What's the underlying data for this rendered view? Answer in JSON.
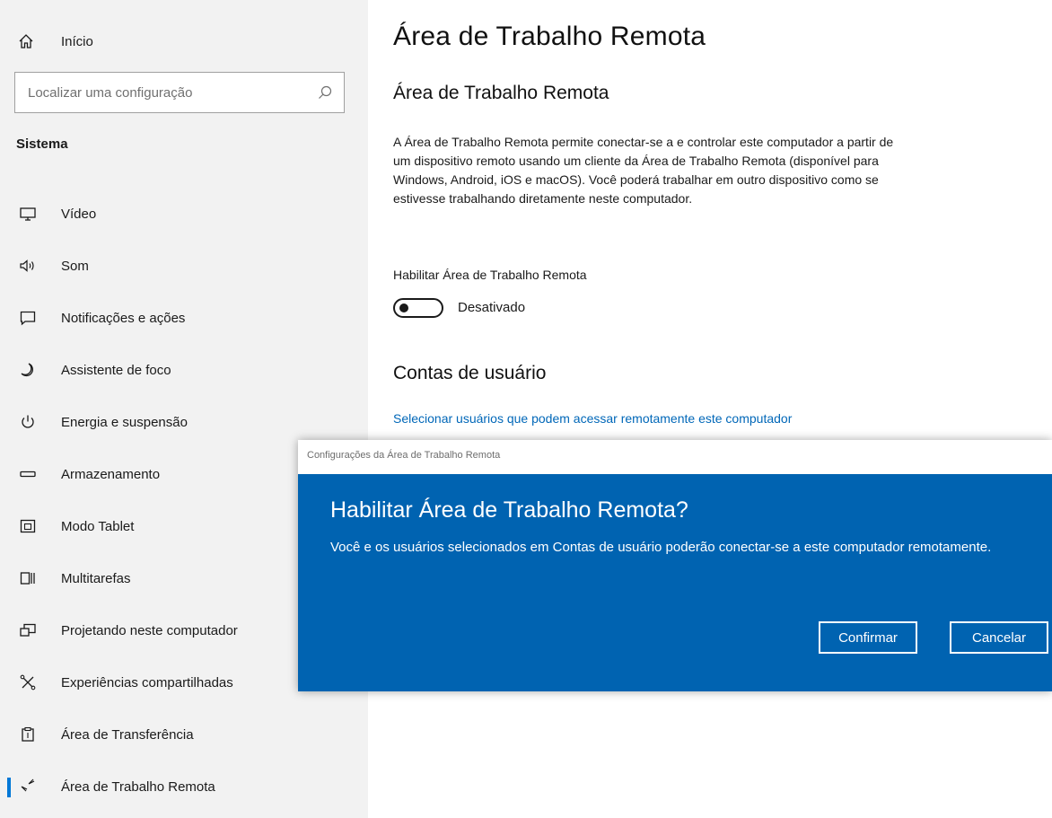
{
  "sidebar": {
    "home_label": "Início",
    "search_placeholder": "Localizar uma configuração",
    "section_title": "Sistema",
    "items": [
      {
        "label": "Vídeo",
        "icon": "monitor-icon"
      },
      {
        "label": "Som",
        "icon": "speaker-icon"
      },
      {
        "label": "Notificações e ações",
        "icon": "notification-icon"
      },
      {
        "label": "Assistente de foco",
        "icon": "moon-icon"
      },
      {
        "label": "Energia e suspensão",
        "icon": "power-icon"
      },
      {
        "label": "Armazenamento",
        "icon": "storage-icon"
      },
      {
        "label": "Modo Tablet",
        "icon": "tablet-icon"
      },
      {
        "label": "Multitarefas",
        "icon": "multitask-icon"
      },
      {
        "label": "Projetando neste computador",
        "icon": "project-icon"
      },
      {
        "label": "Experiências compartilhadas",
        "icon": "shared-icon"
      },
      {
        "label": "Área de Transferência",
        "icon": "clipboard-icon"
      },
      {
        "label": "Área de Trabalho Remota",
        "icon": "remote-desktop-icon",
        "selected": true
      }
    ]
  },
  "main": {
    "title": "Área de Trabalho Remota",
    "subtitle": "Área de Trabalho Remota",
    "description": "A Área de Trabalho Remota permite conectar-se a e controlar este computador a partir de um dispositivo remoto usando um cliente da Área de Trabalho Remota (disponível para Windows, Android, iOS e macOS). Você poderá trabalhar em outro dispositivo como se estivesse trabalhando diretamente neste computador.",
    "toggle_label": "Habilitar Área de Trabalho Remota",
    "toggle_state": "Desativado",
    "accounts_title": "Contas de usuário",
    "accounts_link": "Selecionar usuários que podem acessar remotamente este computador"
  },
  "dialog": {
    "window_title": "Configurações da Área de Trabalho Remota",
    "heading": "Habilitar Área de Trabalho Remota?",
    "message": "Você e os usuários selecionados em Contas de usuário poderão conectar-se a este computador remotamente.",
    "confirm_label": "Confirmar",
    "cancel_label": "Cancelar"
  },
  "colors": {
    "sidebar_bg": "#f2f2f2",
    "accent": "#0078d7",
    "dialog_bg": "#0063b1",
    "link": "#0067b8"
  }
}
